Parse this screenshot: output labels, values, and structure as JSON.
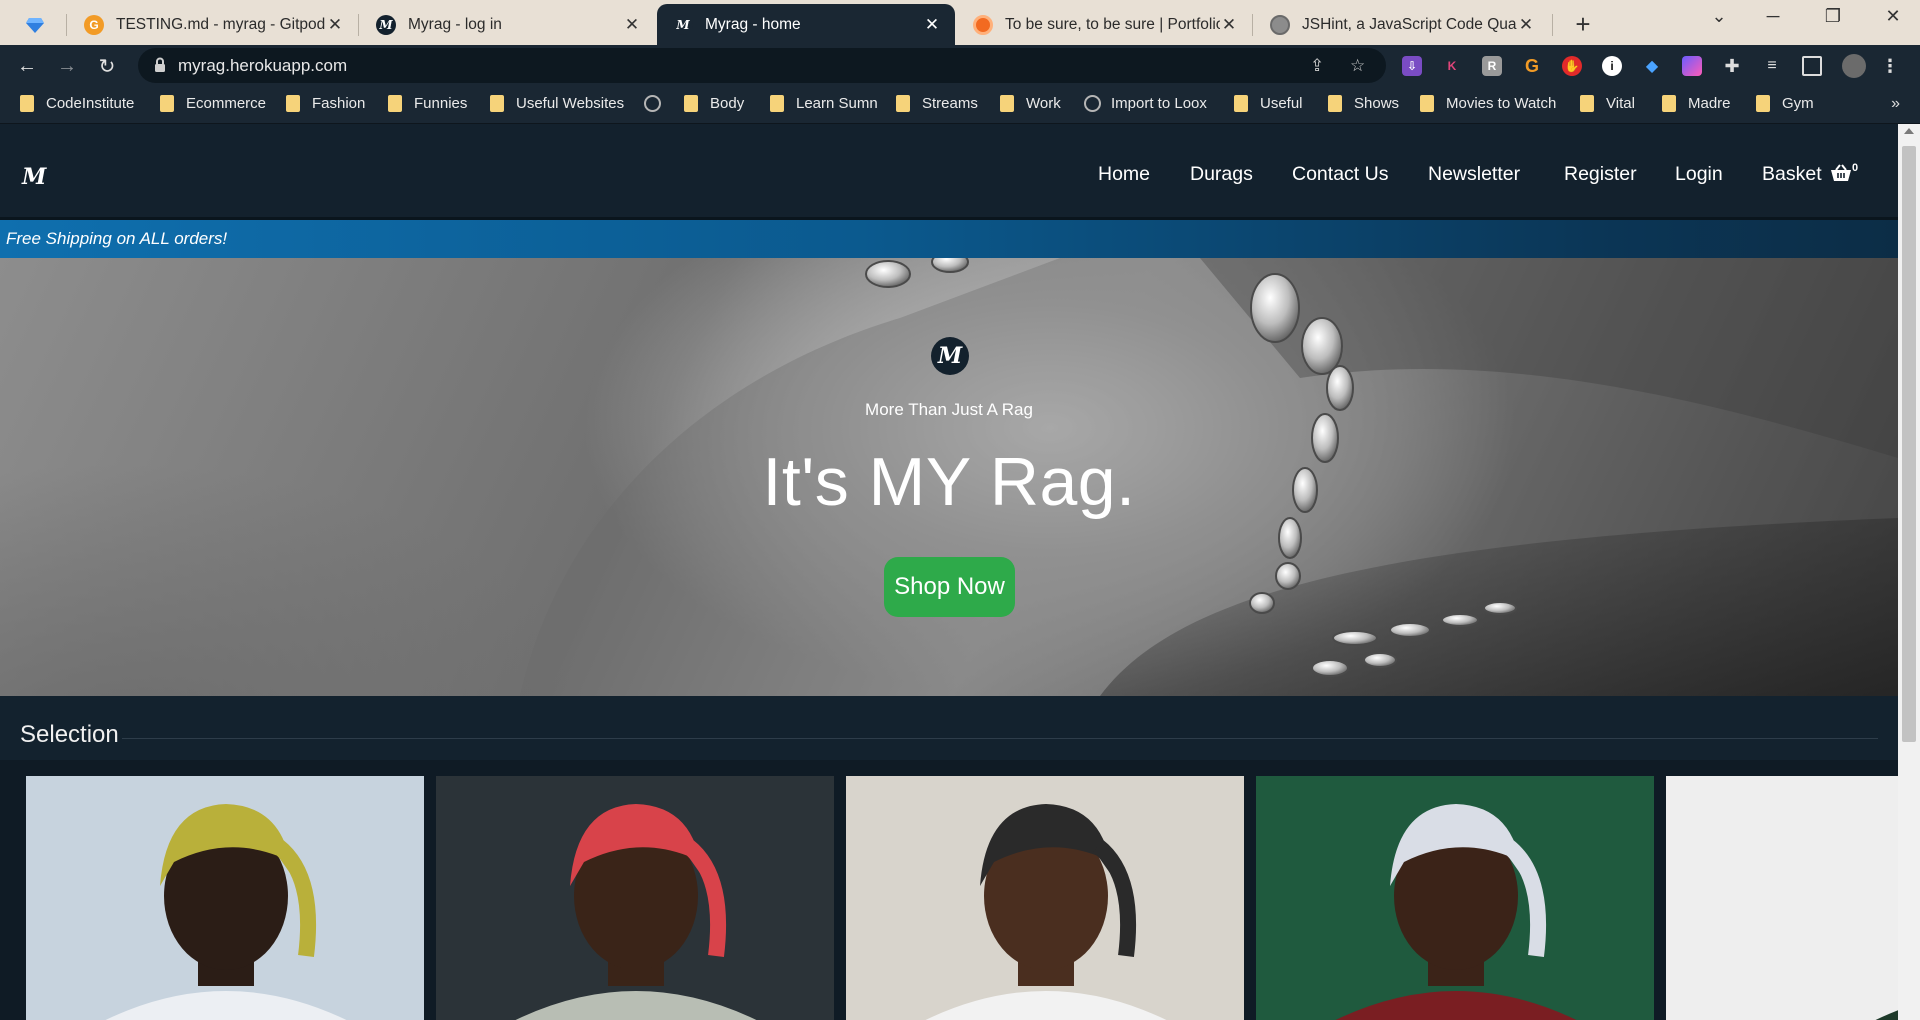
{
  "browser": {
    "tabs": [
      {
        "title": "TESTING.md - myrag - Gitpod Co",
        "favicon": "gitpod-icon",
        "active": false
      },
      {
        "title": "Myrag - log in",
        "favicon": "myrag-m-icon",
        "active": false
      },
      {
        "title": "Myrag - home",
        "favicon": "myrag-m-icon",
        "active": true
      },
      {
        "title": "To be sure, to be sure | Portfolio",
        "favicon": "circle-icon",
        "active": false
      },
      {
        "title": "JSHint, a JavaScript Code Quality",
        "favicon": "globe-icon",
        "active": false
      }
    ],
    "url": "myrag.herokuapp.com",
    "bookmarks": [
      {
        "label": "CodeInstitute",
        "type": "folder"
      },
      {
        "label": "Ecommerce",
        "type": "folder"
      },
      {
        "label": "Fashion",
        "type": "folder"
      },
      {
        "label": "Funnies",
        "type": "folder"
      },
      {
        "label": "Useful Websites",
        "type": "folder"
      },
      {
        "label": "",
        "type": "globe"
      },
      {
        "label": "Body",
        "type": "folder"
      },
      {
        "label": "Learn Sumn",
        "type": "folder"
      },
      {
        "label": "Streams",
        "type": "folder"
      },
      {
        "label": "Work",
        "type": "folder"
      },
      {
        "label": "Import to Loox",
        "type": "globe"
      },
      {
        "label": "Useful",
        "type": "folder"
      },
      {
        "label": "Shows",
        "type": "folder"
      },
      {
        "label": "Movies to Watch",
        "type": "folder"
      },
      {
        "label": "Vital",
        "type": "folder"
      },
      {
        "label": "Madre",
        "type": "folder"
      },
      {
        "label": "Gym",
        "type": "folder"
      }
    ],
    "bookmarks_more": "»"
  },
  "site": {
    "brand": "M",
    "nav": [
      "Home",
      "Durags",
      "Contact Us",
      "Newsletter",
      "Register",
      "Login",
      "Basket"
    ],
    "basket_count": "0",
    "banner": "Free Shipping on ALL orders!",
    "hero": {
      "logo": "M",
      "tagline": "More Than Just A Rag",
      "title": "It's MY Rag.",
      "cta": "Shop Now"
    },
    "section_title": "Selection",
    "products": [
      {
        "durag_color": "#b9b03a",
        "bg": "#c7d3de"
      },
      {
        "durag_color": "#d8434a",
        "bg": "#2b3338"
      },
      {
        "durag_color": "#2a2a2a",
        "bg": "#d8d4cc"
      },
      {
        "durag_color": "#d9dde6",
        "bg": "#1f5a3e"
      },
      {
        "durag_color": "#5a3a8c",
        "bg": "#eeeeee"
      }
    ]
  }
}
